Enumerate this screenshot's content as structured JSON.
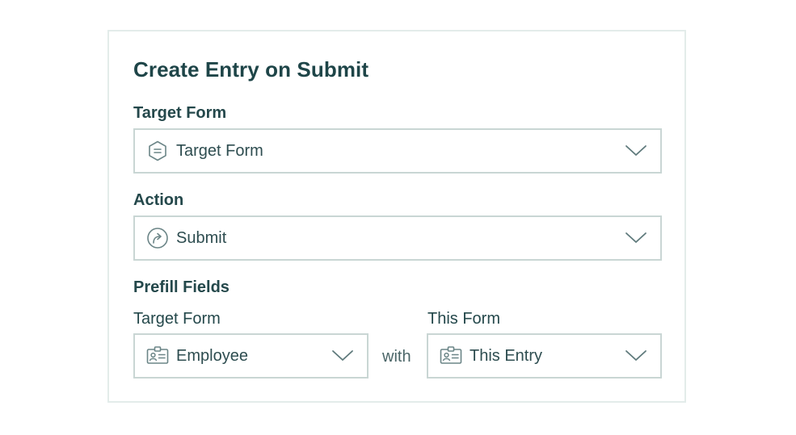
{
  "panel": {
    "title": "Create Entry on Submit"
  },
  "target_form": {
    "label": "Target Form",
    "value": "Target Form",
    "icon": "form-hexagon-icon"
  },
  "action": {
    "label": "Action",
    "value": "Submit",
    "icon": "submit-arrow-icon"
  },
  "prefill": {
    "heading": "Prefill Fields",
    "left_label": "Target Form",
    "left_value": "Employee",
    "left_icon": "contact-card-icon",
    "connector": "with",
    "right_label": "This Form",
    "right_value": "This Entry",
    "right_icon": "contact-card-icon"
  },
  "colors": {
    "heading": "#1e4548",
    "border": "#c9d6d4",
    "icon": "#6b8587"
  }
}
